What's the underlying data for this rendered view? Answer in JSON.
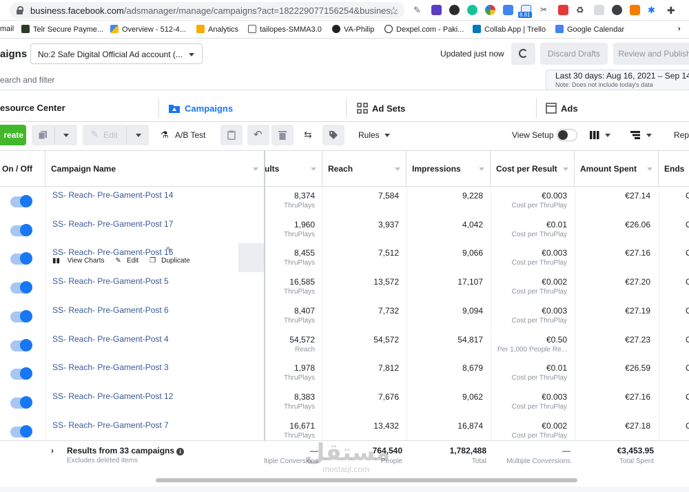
{
  "browser": {
    "url_host": "business.facebook.com",
    "url_path": "/adsmanager/manage/campaigns?act=182229077156254&busines...",
    "extension_badge": "8.81",
    "bookmarks": [
      "mail",
      "Telr Secure Payme...",
      "Overview - 512-4...",
      "Analytics",
      "tailopes-SMMA3.0",
      "VA-Philip",
      "Dexpel.com - Paki...",
      "Collab App | Trello",
      "Google Calendar"
    ]
  },
  "header": {
    "app_title": "aigns",
    "account_name": "No:2 Safe Digital Official Ad account (...",
    "updated_text": "Updated just now",
    "discard_label": "Discard Drafts",
    "review_label": "Review and Publish"
  },
  "search": {
    "placeholder": "earch and filter"
  },
  "date_range": {
    "label": "Last 30 days: Aug 16, 2021 – Sep 14,",
    "note": "Note: Does not include today's data"
  },
  "tabs": {
    "resource_center": "esource Center",
    "campaigns": "Campaigns",
    "ad_sets": "Ad Sets",
    "ads": "Ads"
  },
  "toolbar": {
    "create_label": "reate",
    "edit_label": "Edit",
    "ab_test_label": "A/B Test",
    "rules_label": "Rules",
    "view_setup_label": "View Setup",
    "reports_label": "Rep"
  },
  "columns": {
    "on_off": "On / Off",
    "campaign_name": "Campaign Name",
    "results": "ults",
    "reach": "Reach",
    "impressions": "Impressions",
    "cost_per_result": "Cost per Result",
    "amount_spent": "Amount Spent",
    "ends": "Ends"
  },
  "row_actions": {
    "view_charts": "View Charts",
    "edit": "Edit",
    "duplicate": "Duplicate"
  },
  "rows": [
    {
      "name": "SS- Reach- Pre-Gament-Post 14",
      "results": "8,374",
      "results_type": "ThruPlays",
      "reach": "7,584",
      "impressions": "9,228",
      "cpr": "€0.003",
      "cpr_type": "Cost per ThruPlay",
      "spent": "€27.14",
      "ends": "O"
    },
    {
      "name": "SS- Reach- Pre-Gament-Post 17",
      "results": "1,960",
      "results_type": "ThruPlays",
      "reach": "3,937",
      "impressions": "4,042",
      "cpr": "€0.01",
      "cpr_type": "Cost per ThruPlay",
      "spent": "€26.06",
      "ends": "O"
    },
    {
      "name": "SS- Reach- Pre-Gament-Post 16",
      "results": "8,455",
      "results_type": "ThruPlays",
      "reach": "7,512",
      "impressions": "9,066",
      "cpr": "€0.003",
      "cpr_type": "Cost per ThruPlay",
      "spent": "€27.16",
      "ends": "O"
    },
    {
      "name": "SS- Reach- Pre-Gament-Post 5",
      "results": "16,585",
      "results_type": "ThruPlays",
      "reach": "13,572",
      "impressions": "17,107",
      "cpr": "€0.002",
      "cpr_type": "Cost per ThruPlay",
      "spent": "€27.20",
      "ends": "O"
    },
    {
      "name": "SS- Reach- Pre-Gament-Post 6",
      "results": "8,407",
      "results_type": "ThruPlays",
      "reach": "7,732",
      "impressions": "9,094",
      "cpr": "€0.003",
      "cpr_type": "Cost per ThruPlay",
      "spent": "€27.19",
      "ends": "O"
    },
    {
      "name": "SS- Reach- Pre-Gament-Post 4",
      "results": "54,572",
      "results_type": "Reach",
      "reach": "54,572",
      "impressions": "54,817",
      "cpr": "€0.50",
      "cpr_type": "Per 1,000 People Re...",
      "spent": "€27.23",
      "ends": "O"
    },
    {
      "name": "SS- Reach- Pre-Gament-Post 3",
      "results": "1,978",
      "results_type": "ThruPlays",
      "reach": "7,812",
      "impressions": "8,679",
      "cpr": "€0.01",
      "cpr_type": "Cost per ThruPlay",
      "spent": "€26.59",
      "ends": "O"
    },
    {
      "name": "SS- Reach- Pre-Gament-Post 12",
      "results": "8,383",
      "results_type": "ThruPlays",
      "reach": "7,676",
      "impressions": "9,062",
      "cpr": "€0.003",
      "cpr_type": "Cost per ThruPlay",
      "spent": "€27.16",
      "ends": "O"
    },
    {
      "name": "SS- Reach- Pre-Gament-Post 7",
      "results": "16,671",
      "results_type": "ThruPlays",
      "reach": "13,432",
      "impressions": "16,874",
      "cpr": "€0.002",
      "cpr_type": "Cost per ThruPlay",
      "spent": "€27.18",
      "ends": "O"
    }
  ],
  "totals": {
    "title": "Results from 33 campaigns",
    "subtitle": "Excludes deleted items",
    "results": "—",
    "results_type": "ltiple Conversions",
    "reach": "764,540",
    "reach_type": "People",
    "impressions": "1,782,488",
    "impressions_type": "Total",
    "cpr": "—",
    "cpr_type": "Multiple Conversions",
    "spent": "€3,453.95",
    "spent_type": "Total Spent"
  },
  "watermark": {
    "big": "مستقل",
    "small": "mostaql.com"
  },
  "colors": {
    "accent": "#1877f2",
    "create_green": "#42b72a",
    "link": "#385898"
  }
}
